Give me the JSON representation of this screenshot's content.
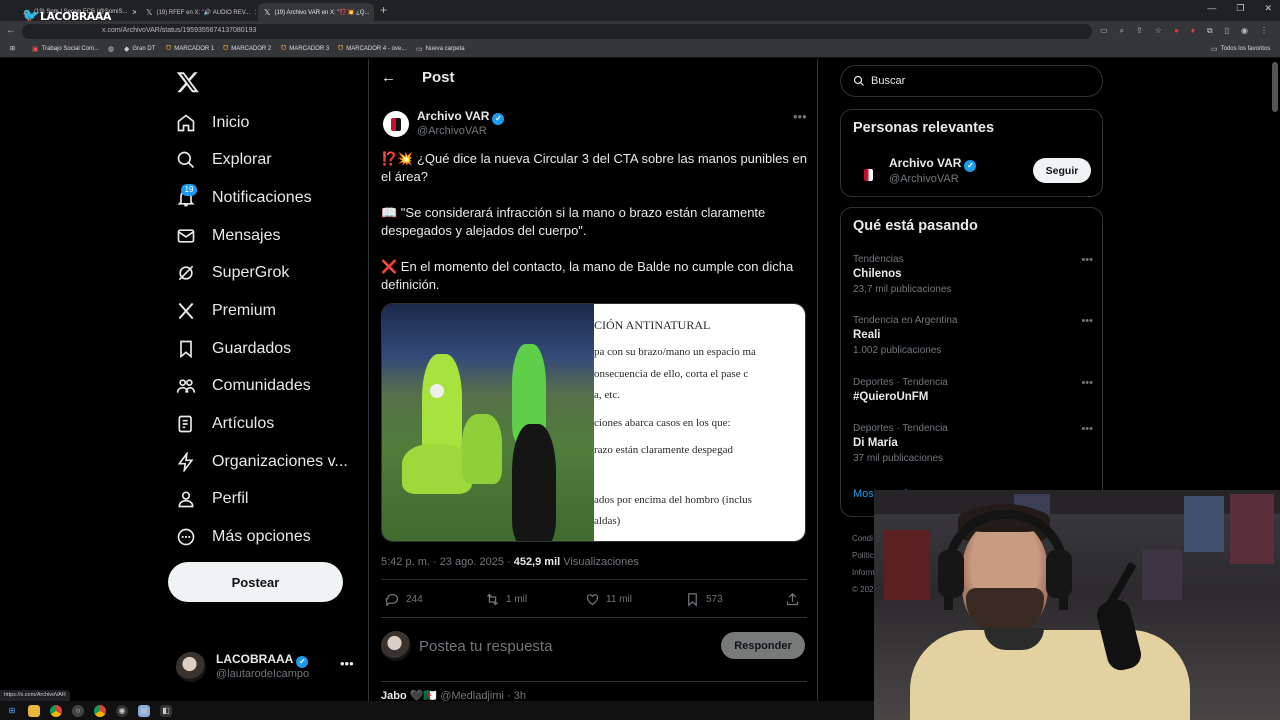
{
  "browser": {
    "tabs": [
      {
        "title": "(19) Som I Serem FCB (@SomiS..."
      },
      {
        "title": "(19) RFEF en X: \"🔊 AUDIO REV..."
      },
      {
        "title": "(19) Archivo VAR en X: \"⁉️💥 ¿Q..."
      }
    ],
    "url": "x.com/ArchivoVAR/status/1959355674137080193",
    "bookmarks": [
      "Trabajo Social Com...",
      "Gran DT",
      "MARCADOR 1",
      "MARCADOR 2",
      "MARCADOR 3",
      "MARCADOR 4 - ove...",
      "Nueva carpeta"
    ],
    "all_bookmarks": "Todos los favoritos",
    "streamer_logo": "LACOBRAAA",
    "status_url": "https://x.com/ArchivoVAR"
  },
  "sidebar": {
    "items": [
      {
        "label": "Inicio",
        "icon": "home-icon"
      },
      {
        "label": "Explorar",
        "icon": "search-icon"
      },
      {
        "label": "Notificaciones",
        "icon": "bell-icon"
      },
      {
        "label": "Mensajes",
        "icon": "mail-icon"
      },
      {
        "label": "SuperGrok",
        "icon": "grok-icon"
      },
      {
        "label": "Premium",
        "icon": "x-icon"
      },
      {
        "label": "Guardados",
        "icon": "bookmark-icon"
      },
      {
        "label": "Comunidades",
        "icon": "people-icon"
      },
      {
        "label": "Artículos",
        "icon": "article-icon"
      },
      {
        "label": "Organizaciones v...",
        "icon": "lightning-icon"
      },
      {
        "label": "Perfil",
        "icon": "person-icon"
      },
      {
        "label": "Más opciones",
        "icon": "more-circle-icon"
      }
    ],
    "notif_count": "19",
    "post_button": "Postear",
    "account": {
      "name": "LACOBRAAA",
      "handle": "@lautarodeIcampo"
    }
  },
  "post": {
    "header": "Post",
    "author": {
      "name": "Archivo VAR",
      "handle": "@ArchivoVAR"
    },
    "paragraphs": [
      "⁉️💥 ¿Qué dice la nueva Circular 3 del CTA sobre las manos punibles en el área?",
      "📖 \"Se considerará infracción si la mano o brazo están claramente despegados y alejados del cuerpo\".",
      "❌ En el momento del contacto, la mano de Balde no cumple con dicha definición."
    ],
    "doc_lines": [
      "CIÓN ANTINATURAL",
      "pa con su brazo/mano un espacio ma",
      "onsecuencia de ello, corta el pase c",
      "a, etc.",
      "ciones abarca casos en los que:",
      "razo   están   claramente   despegad",
      "ados por encima del hombro (inclus",
      "aldas)"
    ],
    "time": "5:42 p. m. · 23 ago. 2025 ·",
    "views": "452,9 mil",
    "views_label": "Visualizaciones",
    "stats": {
      "replies": "244",
      "reposts": "1 mil",
      "likes": "11 mil",
      "bookmarks": "573"
    },
    "reply_placeholder": "Postea tu respuesta",
    "reply_button": "Responder",
    "next_reply": {
      "name": "Jabo 🖤🇩🇿",
      "handle": "@Medladjimi · 3h"
    }
  },
  "right": {
    "search_placeholder": "Buscar",
    "relevant_title": "Personas relevantes",
    "relevant_person": {
      "name": "Archivo VAR",
      "handle": "@ArchivoVAR",
      "button": "Seguir"
    },
    "trends_title": "Qué está pasando",
    "trends": [
      {
        "context": "Tendencias",
        "topic": "Chilenos",
        "count": "23,7 mil publicaciones"
      },
      {
        "context": "Tendencia en Argentina",
        "topic": "Reali",
        "count": "1.002 publicaciones"
      },
      {
        "context": "Deportes · Tendencia",
        "topic": "#QuieroUnFM",
        "count": ""
      },
      {
        "context": "Deportes · Tendencia",
        "topic": "Di María",
        "count": "37 mil publicaciones"
      }
    ],
    "show_more": "Mostrar más",
    "footer": [
      "Condi",
      "Polític",
      "Inform",
      "© 202"
    ]
  },
  "colors": {
    "accent": "#1d9bf0",
    "background": "#000000",
    "border": "#2f3336",
    "muted": "#71767b"
  }
}
